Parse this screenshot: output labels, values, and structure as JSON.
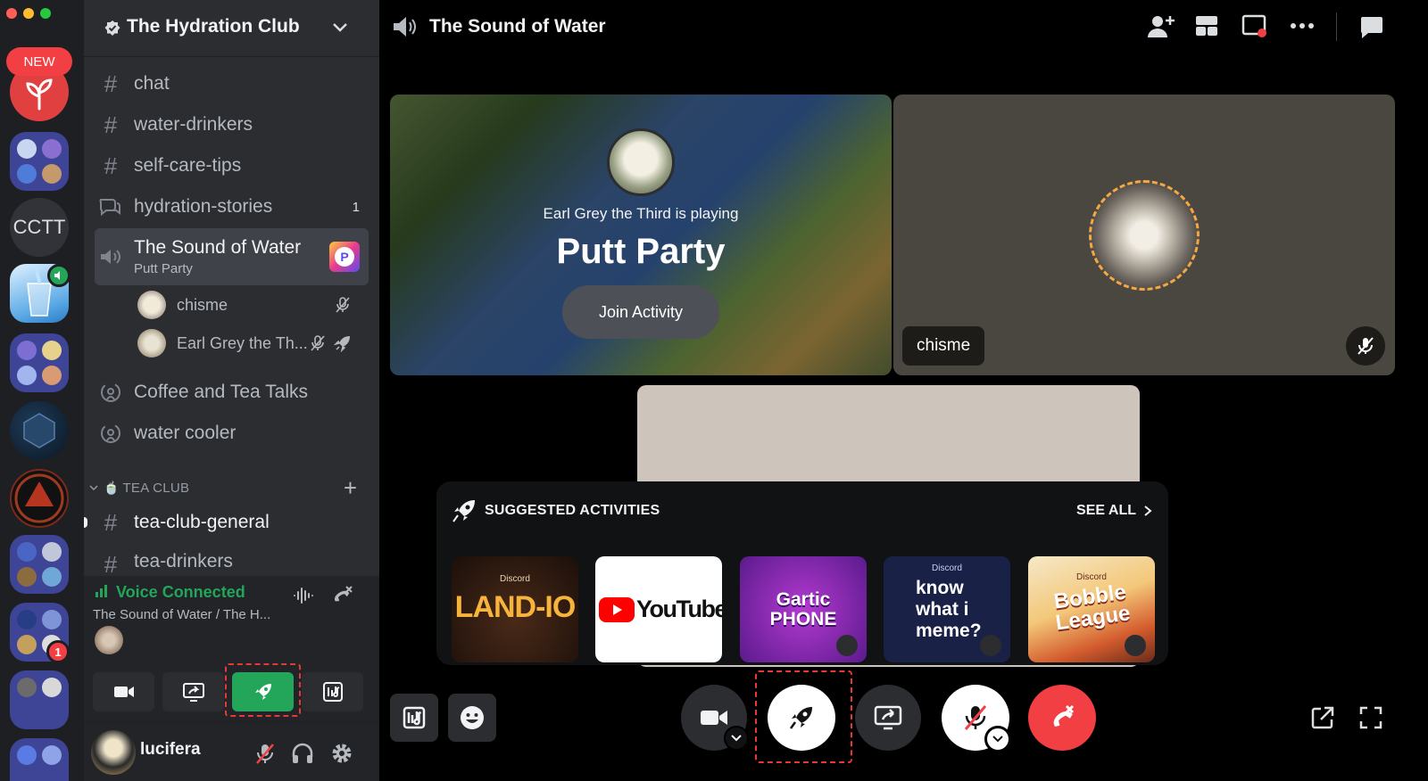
{
  "rail": {
    "new_badge": "NEW",
    "cctt_label": "CCTT",
    "folder_badge": "1"
  },
  "server": {
    "name": "The Hydration Club"
  },
  "channels": [
    {
      "name": "chat",
      "type": "text"
    },
    {
      "name": "water-drinkers",
      "type": "text"
    },
    {
      "name": "self-care-tips",
      "type": "text"
    },
    {
      "name": "hydration-stories",
      "type": "forum",
      "count": "1"
    }
  ],
  "active_voice": {
    "name": "The Sound of Water",
    "activity": "Putt Party",
    "users": [
      {
        "name": "chisme"
      },
      {
        "name": "Earl Grey the Th..."
      }
    ]
  },
  "stage_channels": [
    {
      "name": "Coffee and Tea Talks"
    },
    {
      "name": "water cooler"
    }
  ],
  "category": {
    "name": "TEA CLUB",
    "channels": [
      {
        "name": "tea-club-general"
      },
      {
        "name": "tea-drinkers"
      }
    ]
  },
  "voice_panel": {
    "status": "Voice Connected",
    "location": "The Sound of Water / The H..."
  },
  "user": {
    "name": "lucifera"
  },
  "header": {
    "title": "The Sound of Water"
  },
  "activity_tile": {
    "playing_text": "Earl Grey the Third is playing",
    "game": "Putt Party",
    "join_label": "Join Activity"
  },
  "chisme_tile": {
    "name": "chisme"
  },
  "suggested": {
    "title": "SUGGESTED ACTIVITIES",
    "see_all": "SEE ALL",
    "items": [
      {
        "name": "LAND-IO",
        "tag": "Discord"
      },
      {
        "name": "YouTube"
      },
      {
        "name": "Gartic PHONE"
      },
      {
        "name": "know what i meme?",
        "tag": "Discord"
      },
      {
        "name": "Bobble League",
        "tag": "Discord"
      }
    ]
  },
  "colors": {
    "accent_green": "#23a55a",
    "danger_red": "#f23f43",
    "brand": "#5865f2"
  }
}
